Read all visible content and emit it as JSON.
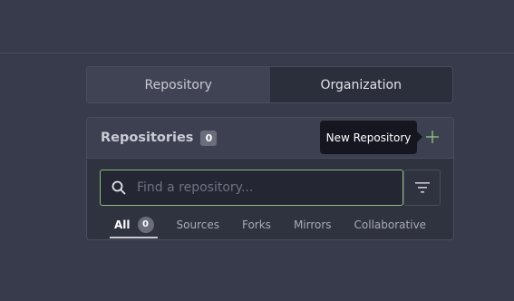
{
  "switcher": {
    "repository_label": "Repository",
    "organization_label": "Organization"
  },
  "repositories": {
    "title": "Repositories",
    "count": "0",
    "new_button_icon": "plus-icon",
    "tooltip": "New Repository",
    "search": {
      "placeholder": "Find a repository...",
      "value": ""
    },
    "tabs": [
      {
        "label": "All",
        "count": "0",
        "active": true
      },
      {
        "label": "Sources"
      },
      {
        "label": "Forks"
      },
      {
        "label": "Mirrors"
      },
      {
        "label": "Collaborative"
      }
    ]
  },
  "colors": {
    "accent_green": "#8bbf7e",
    "background": "#383b4b"
  }
}
